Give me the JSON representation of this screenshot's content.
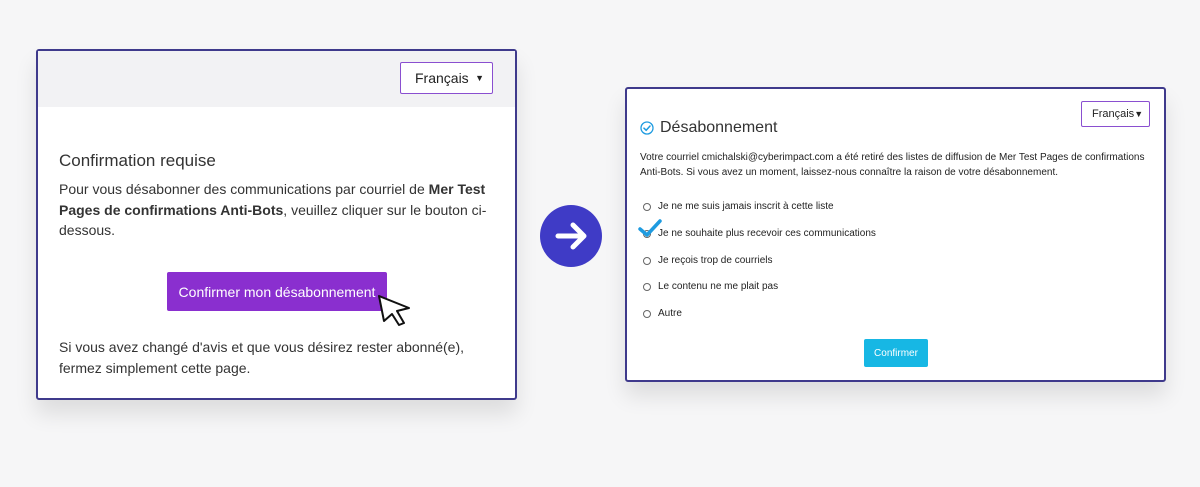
{
  "left": {
    "language": "Français",
    "title": "Confirmation requise",
    "body_prefix": "Pour vous désabonner des communications par courriel de ",
    "body_bold": "Mer Test Pages de confirmations Anti-Bots",
    "body_suffix": ", veuillez cliquer sur le bouton ci-dessous.",
    "confirm_button": "Confirmer mon désabonnement",
    "footer": "Si vous avez changé d'avis et que vous désirez rester abonné(e), fermez simplement cette page."
  },
  "arrow_icon": "arrow-right-icon",
  "right": {
    "language": "Français",
    "title": "Désabonnement",
    "body": "Votre courriel cmichalski@cyberimpact.com a été retiré des listes de diffusion de Mer Test Pages de confirmations Anti-Bots. Si vous avez un moment, laissez-nous connaître la raison de votre désabonnement.",
    "options": [
      {
        "label": "Je ne me suis jamais inscrit à cette liste",
        "selected": false
      },
      {
        "label": "Je ne souhaite plus recevoir ces communications",
        "selected": true
      },
      {
        "label": "Je reçois trop de courriels",
        "selected": false
      },
      {
        "label": "Le contenu ne me plait pas",
        "selected": false
      },
      {
        "label": "Autre",
        "selected": false
      }
    ],
    "confirm_button": "Confirmer"
  },
  "colors": {
    "card_border": "#3f3a8c",
    "purple_button": "#8a2fcf",
    "arrow_circle": "#3f3bc6",
    "cyan_button": "#17b7e4",
    "checkmark": "#1e9be0"
  }
}
